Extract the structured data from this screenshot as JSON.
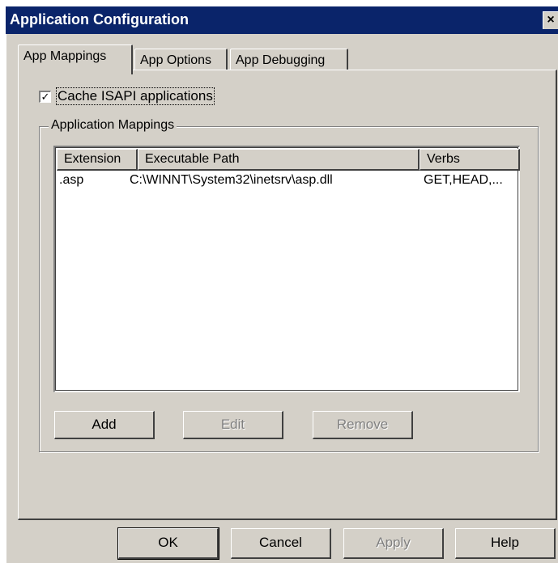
{
  "window": {
    "title": "Application Configuration",
    "close_glyph": "×"
  },
  "tabs": [
    {
      "label": "App Mappings",
      "active": true
    },
    {
      "label": "App Options",
      "active": false
    },
    {
      "label": "App Debugging",
      "active": false
    }
  ],
  "cache_isapi": {
    "label": "Cache ISAPI applications",
    "checked": true,
    "check_glyph": "✓"
  },
  "mappings": {
    "group_label": "Application Mappings",
    "columns": [
      "Extension",
      "Executable Path",
      "Verbs"
    ],
    "rows": [
      {
        "extension": ".asp",
        "path": "C:\\WINNT\\System32\\inetsrv\\asp.dll",
        "verbs": "GET,HEAD,..."
      }
    ],
    "buttons": {
      "add": "Add",
      "edit": "Edit",
      "remove": "Remove"
    }
  },
  "footer": {
    "ok": "OK",
    "cancel": "Cancel",
    "apply": "Apply",
    "help": "Help"
  },
  "colors": {
    "face": "#d4d0c8",
    "titlebar": "#0a246a",
    "disabled_text": "#808080"
  }
}
